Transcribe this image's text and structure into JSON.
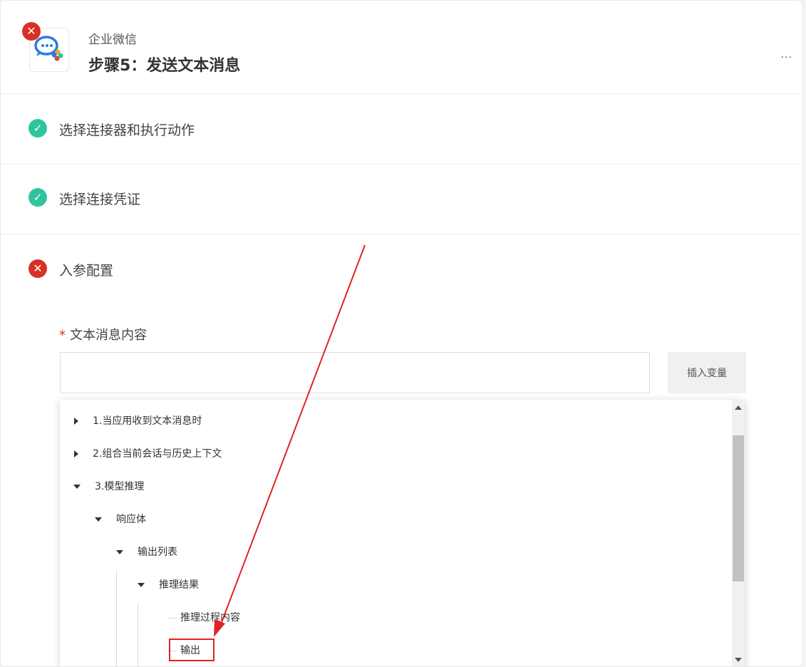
{
  "header": {
    "app_name": "企业微信",
    "step_title": "步骤5：发送文本消息",
    "more_label": "···"
  },
  "sections": [
    {
      "label": "选择连接器和执行动作",
      "status": "complete"
    },
    {
      "label": "选择连接凭证",
      "status": "complete"
    },
    {
      "label": "入参配置",
      "status": "error"
    }
  ],
  "form": {
    "field_label": "文本消息内容",
    "required_mark": "*",
    "input_value": "",
    "insert_button": "插入变量"
  },
  "tree": [
    {
      "label": "1.当应用收到文本消息时",
      "state": "collapsed"
    },
    {
      "label": "2.组合当前会话与历史上下文",
      "state": "collapsed"
    },
    {
      "label": "3.模型推理",
      "state": "expanded"
    },
    {
      "label": "响应体",
      "state": "expanded"
    },
    {
      "label": "输出列表",
      "state": "expanded"
    },
    {
      "label": "推理结果",
      "state": "expanded"
    },
    {
      "label": "推理过程内容",
      "state": "leaf"
    },
    {
      "label": "输出",
      "state": "leaf",
      "highlighted": true
    }
  ],
  "colors": {
    "success": "#2ec4a0",
    "error": "#d93025",
    "annotation": "#e02424"
  }
}
